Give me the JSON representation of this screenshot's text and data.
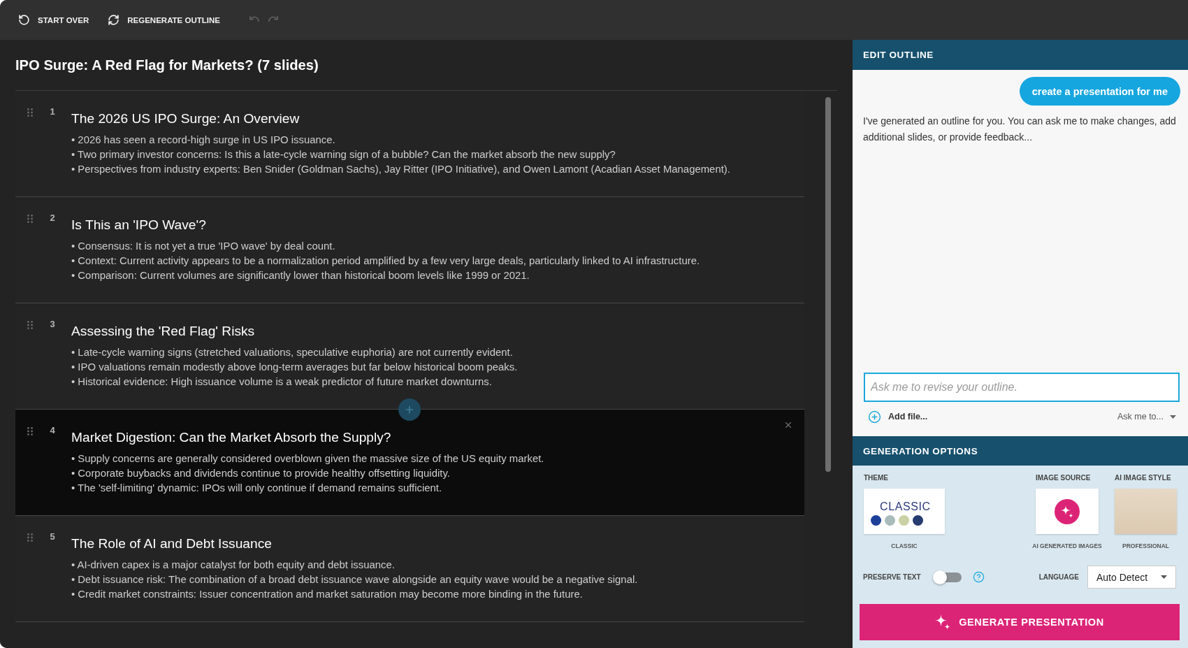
{
  "toolbar": {
    "buttons": [
      {
        "kind": "start_over",
        "label": "START OVER"
      },
      {
        "kind": "regenerate",
        "label": "REGENERATE OUTLINE"
      }
    ],
    "undo": {
      "disabled": true
    },
    "redo": {
      "disabled": true
    }
  },
  "outline": {
    "title": "IPO Surge: A Red Flag for Markets? (7 slides)",
    "slides": [
      {
        "number": "1",
        "title": "The 2026 US IPO Surge: An Overview",
        "selected": false,
        "bullets": [
          "• 2026 has seen a record-high surge in US IPO issuance.",
          "• Two primary investor concerns: Is this a late-cycle warning sign of a bubble? Can the market absorb the new supply?",
          "• Perspectives from industry experts: Ben Snider (Goldman Sachs), Jay Ritter (IPO Initiative), and Owen Lamont (Acadian Asset Management)."
        ]
      },
      {
        "number": "2",
        "title": "Is This an 'IPO Wave'?",
        "selected": false,
        "bullets": [
          "• Consensus: It is not yet a true 'IPO wave' by deal count.",
          "• Context: Current activity appears to be a normalization period amplified by a few very large deals, particularly linked to AI infrastructure.",
          "• Comparison: Current volumes are significantly lower than historical boom levels like 1999 or 2021."
        ]
      },
      {
        "number": "3",
        "title": "Assessing the 'Red Flag' Risks",
        "selected": false,
        "bullets": [
          "• Late-cycle warning signs (stretched valuations, speculative euphoria) are not currently evident.",
          "• IPO valuations remain modestly above long-term averages but far below historical boom peaks.",
          "• Historical evidence: High issuance volume is a weak predictor of future market downturns."
        ]
      },
      {
        "number": "4",
        "title": "Market Digestion: Can the Market Absorb the Supply?",
        "selected": true,
        "bullets": [
          "• Supply concerns are generally considered overblown given the massive size of the US equity market.",
          "• Corporate buybacks and dividends continue to provide healthy offsetting liquidity.",
          "• The 'self-limiting' dynamic: IPOs will only continue if demand remains sufficient."
        ]
      },
      {
        "number": "5",
        "title": "The Role of AI and Debt Issuance",
        "selected": false,
        "bullets": [
          "• AI-driven capex is a major catalyst for both equity and debt issuance.",
          "• Debt issuance risk: The combination of a broad debt issuance wave alongside an equity wave would be a negative signal.",
          "• Credit market constraints: Issuer concentration and market saturation may become more binding in the future."
        ]
      }
    ]
  },
  "edit_outline": {
    "title": "EDIT OUTLINE",
    "messages": [
      {
        "kind": "user",
        "text": "create a presentation for me"
      },
      {
        "kind": "assistant",
        "text": "I've generated an outline for you. You can ask me to make changes, add additional slides, or provide feedback..."
      }
    ],
    "input": {
      "placeholder": "Ask me to revise your outline."
    },
    "add_file": "Add file...",
    "ask_menu": "Ask me to..."
  },
  "generation_options": {
    "title": "GENERATION OPTIONS",
    "theme": {
      "label": "THEME",
      "card_title": "CLASSIC",
      "swatches": [
        {
          "color": "#1c3f99"
        },
        {
          "color": "#a9bcbb"
        },
        {
          "color": "#c9d1a5"
        },
        {
          "color": "#263c70"
        }
      ],
      "caption": "CLASSIC"
    },
    "image_source": {
      "label": "IMAGE SOURCE",
      "caption": "AI GENERATED IMAGES"
    },
    "ai_image_style": {
      "label": "AI IMAGE STYLE",
      "caption": "PROFESSIONAL"
    },
    "preserve_text": {
      "label": "PRESERVE TEXT",
      "on": false
    },
    "language": {
      "label": "LANGUAGE",
      "value": "Auto Detect"
    },
    "generate_button": "GENERATE PRESENTATION"
  }
}
